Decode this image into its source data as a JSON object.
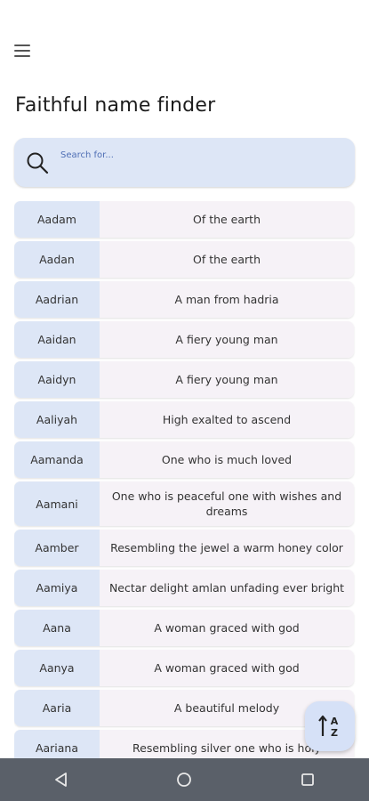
{
  "header": {
    "title": "Faithful name finder",
    "menu_icon": "hamburger-menu-icon"
  },
  "search": {
    "placeholder": "Search for...",
    "value": "",
    "icon": "search-icon"
  },
  "names": [
    {
      "name": "Aadam",
      "meaning": "Of the earth"
    },
    {
      "name": "Aadan",
      "meaning": "Of the earth"
    },
    {
      "name": "Aadrian",
      "meaning": "A man from hadria"
    },
    {
      "name": "Aaidan",
      "meaning": "A fiery young man"
    },
    {
      "name": "Aaidyn",
      "meaning": "A fiery young man"
    },
    {
      "name": "Aaliyah",
      "meaning": "High exalted  to ascend"
    },
    {
      "name": "Aamanda",
      "meaning": "One who is much loved"
    },
    {
      "name": "Aamani",
      "meaning": "One who is peaceful one with wishes and dreams"
    },
    {
      "name": "Aamber",
      "meaning": "Resembling the jewel a warm honey color"
    },
    {
      "name": "Aamiya",
      "meaning": "Nectar delight amlan unfading ever bright"
    },
    {
      "name": "Aana",
      "meaning": "A woman graced with god"
    },
    {
      "name": "Aanya",
      "meaning": "A woman graced with god"
    },
    {
      "name": "Aaria",
      "meaning": "A beautiful melody"
    },
    {
      "name": "Aariana",
      "meaning": "Resembling silver one who is holy"
    }
  ],
  "fab": {
    "icon": "sort-alphabetical-icon",
    "letter_top": "A",
    "letter_bottom": "Z"
  },
  "navbar": {
    "back_icon": "back-triangle-icon",
    "home_icon": "home-circle-icon",
    "recents_icon": "recents-square-icon"
  },
  "colors": {
    "name_cell": "#dde6f6",
    "meaning_cell": "#f6f2f7",
    "search_bg": "#dde6f6",
    "navbar": "#5a6069"
  }
}
